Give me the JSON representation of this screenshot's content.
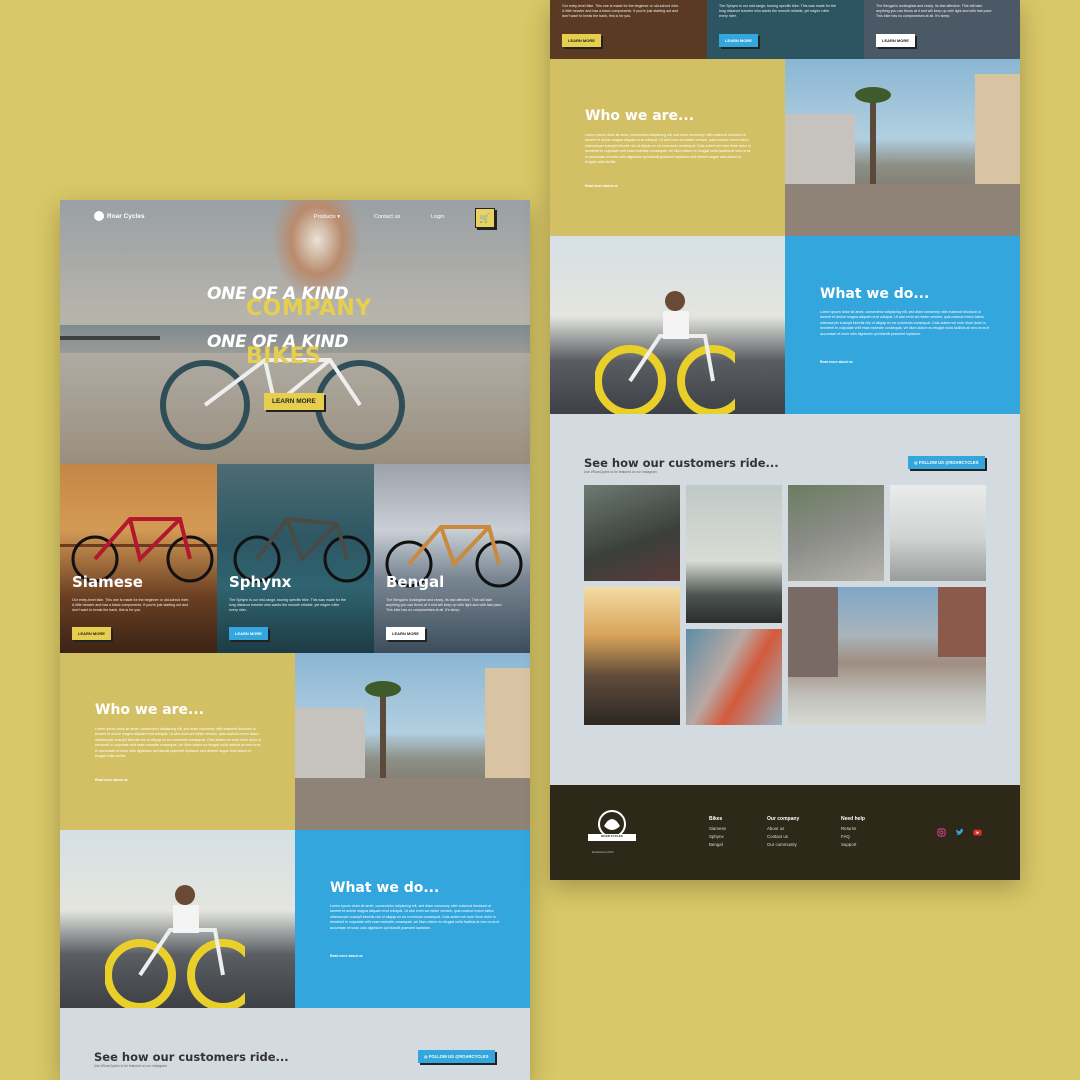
{
  "brand": {
    "name": "Roar Cycles",
    "crest_text": "ROAR CYCLES",
    "tagline": "Established 2020"
  },
  "nav": {
    "products": "Products",
    "contact": "Contact us",
    "login": "Login"
  },
  "hero": {
    "line1": "ONE OF A KIND",
    "word1": "COMPANY",
    "line2": "ONE OF A KIND",
    "word2": "BIKES",
    "cta": "LEARN MORE"
  },
  "cards": [
    {
      "name": "Siamese",
      "desc": "Our entry-level bike. This one is made for the beginner or old-school rider. A little heavier and has a basic components. If you're just starting out and don't want to break the bank, this is for you.",
      "cta": "LEARN MORE",
      "btn_color": "#e6cf4e",
      "btn_text": "#222222"
    },
    {
      "name": "Sphynx",
      "desc": "The Sphynx is our mid-range, touring specific bike. This was made for the long distance traveler who wants the smooth reliable, yet edgier roller every rider.",
      "cta": "LEARN MORE",
      "btn_color": "#33a6dd",
      "btn_text": "#ffffff"
    },
    {
      "name": "Bengal",
      "desc": "The Bengal is lookingfast and ready. Its fast affective. This will take anything you can throw at it and will keep up with light and with fast pace. This bike has no compromises at all. It's steep.",
      "cta": "LEARN MORE",
      "btn_color": "#ffffff",
      "btn_text": "#222222"
    }
  ],
  "who": {
    "title": "Who we are...",
    "body": "Lorem ipsum dolor sit amet, consectetur adipiscing elit, sed diam nonummy nibh euismod tincidunt ut laoreet et dolore magna aliquam erat volutpat. Ut wisi enim ad minim veniam, quis nostrud exerci tation ullamcorper suscipit lobortis nisl ut aliquip ex ea commodo consequat. Duis autem vel eum iriure dolor in hendrerit in vulputate velit esse molestie consequat, vel illum dolore eu feugiat nulla facilisis at vero eros et accumsan et iusto odio dignissim qui blandit praesent luptatum zzril delenit augue duis dolore te feugait nulla facilisi.",
    "link": "Read more about us"
  },
  "what": {
    "title": "What we do...",
    "body": "Lorem ipsum dolor sit amet, consectetur adipiscing elit, sed diam nonummy nibh euismod tincidunt ut laoreet et dolore magna aliquam erat volutpat. Ut wisi enim ad minim veniam, quis nostrud exerci tation ullamcorper suscipit lobortis nisl ut aliquip ex ea commodo consequat. Duis autem vel eum iriure dolor in hendrerit in vulputate velit esse molestie consequat, vel illum dolore eu feugiat nulla facilisis at vero eros et accumsan et iusto odio dignissim qui blandit praesent luptatum.",
    "link": "Read more about us"
  },
  "gallery": {
    "title": "See how our customers ride...",
    "subtitle": "Use #RoarCycles to be featured on our Instagram",
    "follow": "FOLLOW US @ROARCYCLES"
  },
  "footer": {
    "columns": [
      {
        "heading": "Bikes",
        "links": [
          "Siamese",
          "Sphynx",
          "Bengal"
        ]
      },
      {
        "heading": "Our company",
        "links": [
          "About us",
          "Contact us",
          "Our community"
        ]
      },
      {
        "heading": "Need help",
        "links": [
          "Returns",
          "FAQ",
          "Support"
        ]
      }
    ],
    "social": [
      "instagram-icon",
      "twitter-icon",
      "youtube-icon"
    ]
  },
  "colors": {
    "background": "#d9c867",
    "yellow": "#e6cf4e",
    "blue": "#33a6dd",
    "mustard": "#d4c064",
    "gallery_bg": "#d3dbe1",
    "footer_bg": "#2d2817"
  }
}
